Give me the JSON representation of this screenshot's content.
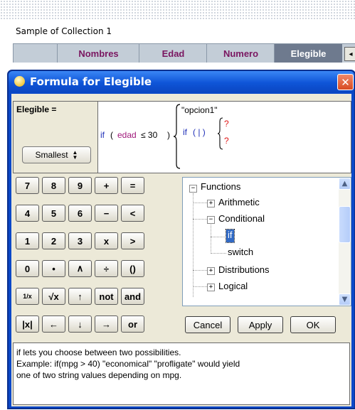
{
  "collection": {
    "title": "Sample of Collection 1",
    "columns": [
      "Nombres",
      "Edad",
      "Numero",
      "Elegible"
    ],
    "selected_column": "Elegible"
  },
  "dialog": {
    "title": "Formula for Elegible",
    "close_glyph": "✕",
    "lhs_label": "Elegible =",
    "font_size_select": "Smallest",
    "formula": {
      "if_kw": "if",
      "open_paren": "(",
      "variable": "edad",
      "comparison": "≤ 30",
      "close_paren": ")",
      "true_branch": "\"opcion1\"",
      "nested_if_kw": "if",
      "nested_args": "( | )",
      "placeholder_1": "?",
      "placeholder_2": "?"
    },
    "keypad": [
      [
        "7",
        "8",
        "9",
        "+",
        "="
      ],
      [
        "4",
        "5",
        "6",
        "−",
        "<"
      ],
      [
        "1",
        "2",
        "3",
        "x",
        ">"
      ],
      [
        "0",
        "•",
        "∧",
        "÷",
        "()"
      ],
      [
        "1/x",
        "√x",
        "↑",
        "not",
        "and"
      ],
      [
        "|x|",
        "←",
        "↓",
        "→",
        "or"
      ]
    ],
    "function_tree": {
      "root": "Functions",
      "items": [
        "Arithmetic",
        "Conditional",
        "if",
        "switch",
        "Distributions",
        "Logical"
      ],
      "selected": "if"
    },
    "buttons": {
      "cancel": "Cancel",
      "apply": "Apply",
      "ok": "OK"
    },
    "help_lines": [
      "if lets you choose between two possibilities.",
      "Example: if(mpg > 40) \"economical\" \"profligate\" would yield",
      "one of two string values depending on mpg."
    ]
  },
  "colors": {
    "titlebar": "#0f55d8",
    "column_text": "#7a1660",
    "selected_column_bg": "#6e7a8e",
    "keyword": "#2030b8",
    "variable": "#a0187a",
    "placeholder": "#e01818",
    "tree_selection": "#316ac5"
  }
}
